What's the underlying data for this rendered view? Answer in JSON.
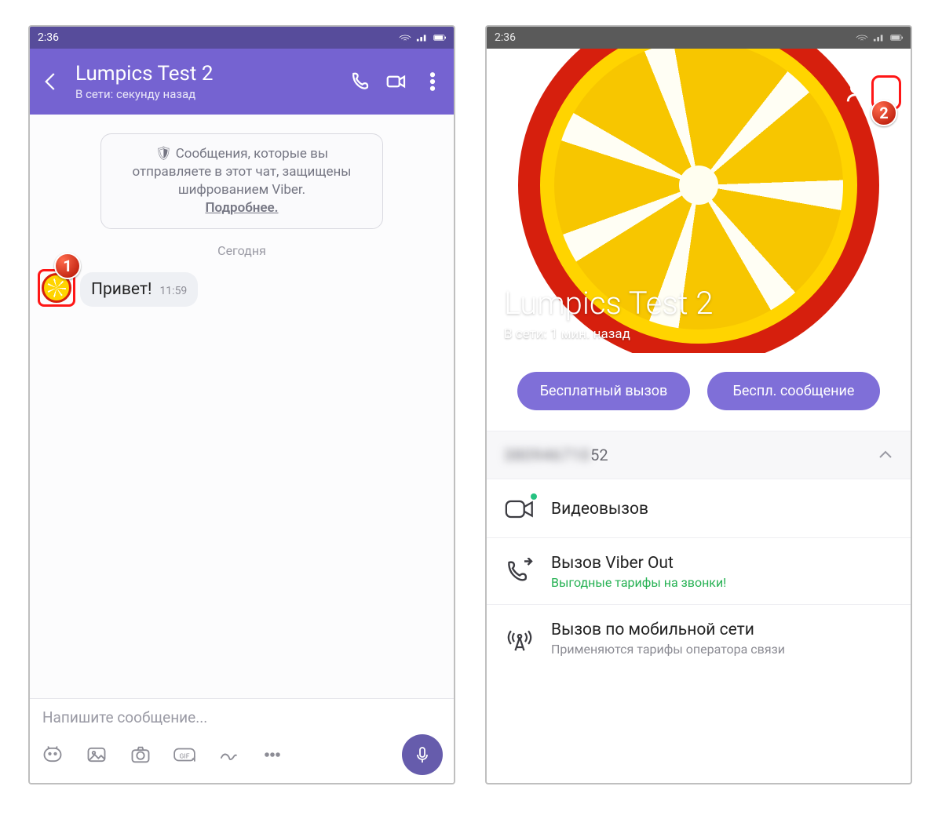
{
  "statusbar": {
    "time": "2:36"
  },
  "chat": {
    "contact_name": "Lumpics Test 2",
    "presence": "В сети: секунду назад",
    "encryption_notice": "Сообщения, которые вы отправляете в этот чат, защищены шифрованием Viber.",
    "learn_more": "Подробнее.",
    "date_separator": "Сегодня",
    "message_text": "Привет!",
    "message_time": "11:59",
    "input_placeholder": "Напишите сообщение..."
  },
  "profile": {
    "name": "Lumpics Test 2",
    "presence": "В сети: 1 мин. назад",
    "cta_call": "Бесплатный вызов",
    "cta_message": "Беспл. сообщение",
    "phone_number_blurred": "380946710",
    "phone_number_suffix": "52",
    "actions": {
      "video": "Видеовызов",
      "viber_out": "Вызов Viber Out",
      "viber_out_sub": "Выгодные тарифы на звонки!",
      "cellular": "Вызов по мобильной сети",
      "cellular_sub": "Применяются тарифы оператора связи"
    }
  },
  "annotations": {
    "step1": "1",
    "step2": "2"
  }
}
